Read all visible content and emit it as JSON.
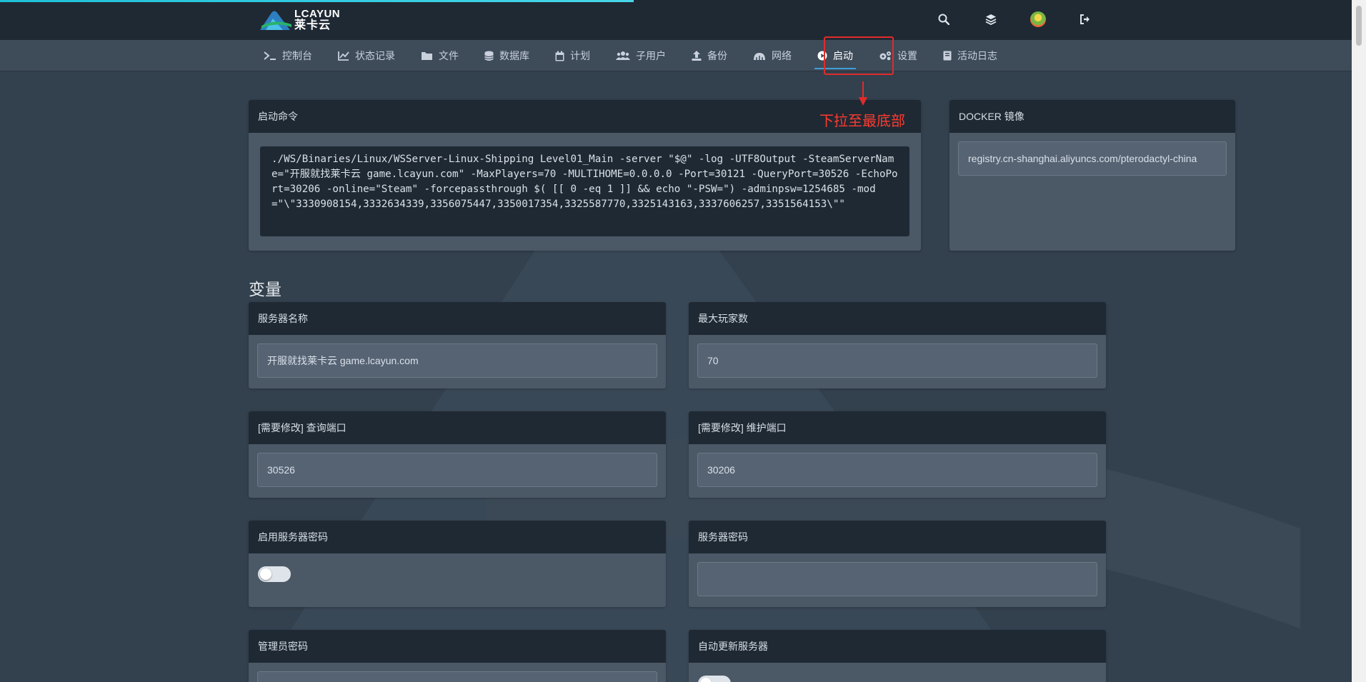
{
  "brand": {
    "logo_en": "LCAYUN",
    "logo_cn": "莱卡云"
  },
  "header_icons": [
    "search-icon",
    "layers-icon",
    "avatar",
    "logout-icon"
  ],
  "nav": {
    "items": [
      {
        "label": "控制台",
        "icon": "terminal-icon"
      },
      {
        "label": "状态记录",
        "icon": "chart-icon"
      },
      {
        "label": "文件",
        "icon": "folder-icon"
      },
      {
        "label": "数据库",
        "icon": "database-icon"
      },
      {
        "label": "计划",
        "icon": "calendar-icon"
      },
      {
        "label": "子用户",
        "icon": "users-icon"
      },
      {
        "label": "备份",
        "icon": "upload-icon"
      },
      {
        "label": "网络",
        "icon": "network-icon"
      },
      {
        "label": "启动",
        "icon": "play-icon",
        "active": true
      },
      {
        "label": "设置",
        "icon": "gears-icon"
      },
      {
        "label": "活动日志",
        "icon": "book-icon"
      }
    ]
  },
  "annotation": {
    "text": "下拉至最底部",
    "color": "#e02b2b"
  },
  "startup": {
    "title": "启动命令",
    "command": "./WS/Binaries/Linux/WSServer-Linux-Shipping Level01_Main -server \"$@\" -log -UTF8Output -SteamServerName=\"开服就找莱卡云 game.lcayun.com\" -MaxPlayers=70 -MULTIHOME=0.0.0.0 -Port=30121 -QueryPort=30526 -EchoPort=30206 -online=\"Steam\" -forcepassthrough $( [[ 0 -eq 1 ]] && echo \"-PSW=\") -adminpsw=1254685 -mod=\"\\\"3330908154,3332634339,3356075447,3350017354,3325587770,3325143163,3337606257,3351564153\\\"\""
  },
  "docker": {
    "title": "DOCKER 镜像",
    "value": "registry.cn-shanghai.aliyuncs.com/pterodactyl-china"
  },
  "variables": {
    "section_title": "变量",
    "server_name": {
      "label": "服务器名称",
      "value": "开服就找莱卡云 game.lcayun.com"
    },
    "max_players": {
      "label": "最大玩家数",
      "value": "70"
    },
    "query_port": {
      "label": "[需要修改] 查询端口",
      "value": "30526"
    },
    "echo_port": {
      "label": "[需要修改] 维护端口",
      "value": "30206"
    },
    "enable_password": {
      "label": "启用服务器密码",
      "enabled": false
    },
    "server_password": {
      "label": "服务器密码",
      "value": ""
    },
    "admin_password": {
      "label": "管理员密码",
      "value": ""
    },
    "auto_update": {
      "label": "自动更新服务器",
      "enabled": false
    }
  },
  "colors": {
    "background": "#33404d",
    "header": "#1f2933",
    "nav": "#3e4b59",
    "card": "#4b5866",
    "accent": "#3f9ed8",
    "loading_bar": "#1ec0d8"
  }
}
